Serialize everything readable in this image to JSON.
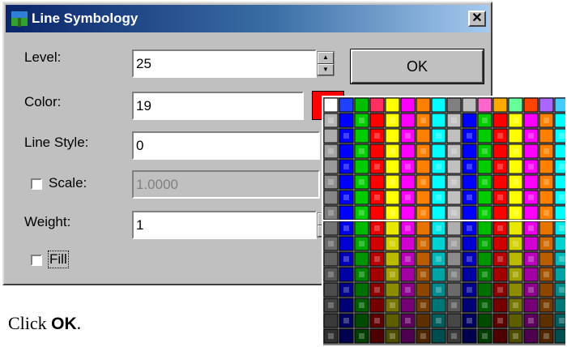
{
  "dialog": {
    "title": "Line Symbology",
    "close_glyph": "✕",
    "level": {
      "label": "Level:",
      "value": "25"
    },
    "color": {
      "label": "Color:",
      "value": "19",
      "swatch": "#ff0000"
    },
    "line_style": {
      "label": "Line Style:",
      "value": "0"
    },
    "scale": {
      "label": "Scale:",
      "value": "1.0000",
      "checked": false
    },
    "weight": {
      "label": "Weight:",
      "value": "1"
    },
    "fill": {
      "label": "Fill",
      "checked": false
    },
    "ok_label": "OK"
  },
  "caption": {
    "prefix": "Click ",
    "bold": "OK",
    "suffix": "."
  },
  "palette": {
    "columns": 16,
    "rows": 16,
    "hue_cycle": [
      "#0000ff",
      "#00cc00",
      "#ff0000",
      "#ffff00",
      "#ff00ff",
      "#ff8000",
      "#00ffff",
      "#c0c0c0"
    ],
    "top_row": [
      "#ffffff",
      "#2040ff",
      "#00c000",
      "#ff3060",
      "#ffff00",
      "#ff00ff",
      "#ff8000",
      "#00ffff",
      "#808080",
      "#c0c0c0",
      "#ff66cc",
      "#ffaa00",
      "#66ff99",
      "#ff4400",
      "#aa66ff",
      "#44ccff"
    ]
  }
}
